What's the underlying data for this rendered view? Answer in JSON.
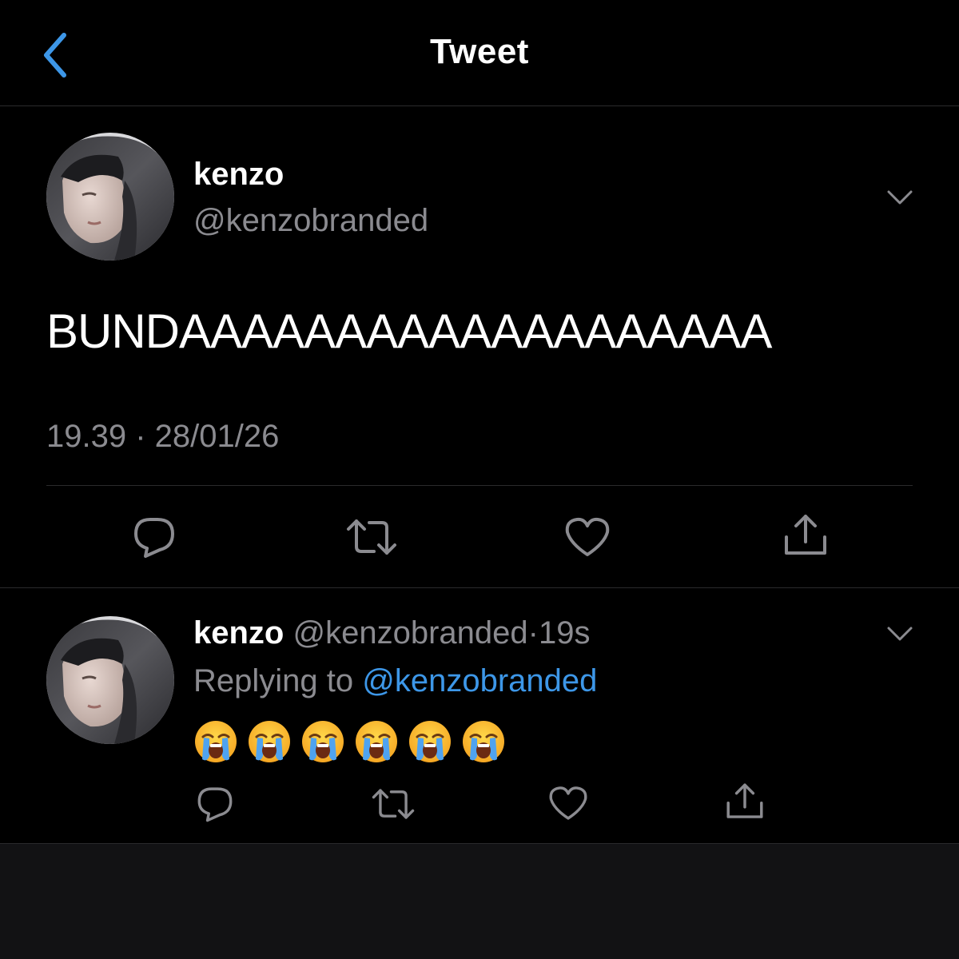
{
  "header": {
    "title": "Tweet",
    "back_icon": "chevron-left-icon"
  },
  "colors": {
    "background": "#000000",
    "accent": "#3d97e8",
    "secondary_text": "#8b8b90",
    "divider": "#2a2a2c"
  },
  "main_tweet": {
    "author_name": "kenzo",
    "author_handle": "@kenzobranded",
    "text": "BUNDAAAAAAAAAAAAAAAAAAA",
    "timestamp": "19.39 · 28/01/26",
    "actions": [
      "reply-icon",
      "retweet-icon",
      "like-icon",
      "share-icon"
    ]
  },
  "reply_tweet": {
    "author_name": "kenzo",
    "author_handle": "@kenzobranded",
    "separator": "·",
    "time_ago": "19s",
    "replying_label": "Replying to",
    "replying_to": "@kenzobranded",
    "emojis": [
      "😭",
      "😭",
      "😭",
      "😭",
      "😭",
      "😭"
    ],
    "emoji_icon": "loudly-crying-face-icon",
    "actions": [
      "reply-icon",
      "retweet-icon",
      "like-icon",
      "share-icon"
    ]
  }
}
